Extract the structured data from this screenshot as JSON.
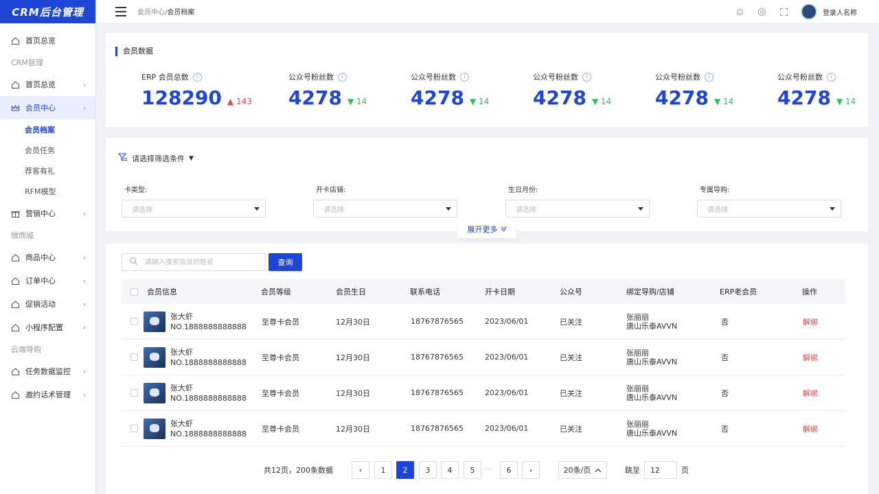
{
  "app": {
    "logo": "CRM后台管理"
  },
  "topbar": {
    "breadcrumb_parent": "会员中心/",
    "breadcrumb_current": "会员档案",
    "username": "登录人名称"
  },
  "sidebar": {
    "items": [
      {
        "label": "首页总览"
      },
      {
        "group": "CRM管理"
      },
      {
        "label": "首页总览"
      },
      {
        "label": "会员中心"
      },
      {
        "sub": [
          "会员档案",
          "会员任务",
          "荐客有礼",
          "RFM模型"
        ]
      },
      {
        "label": "营销中心"
      },
      {
        "group": "微商城"
      },
      {
        "label": "商品中心"
      },
      {
        "label": "订单中心"
      },
      {
        "label": "促销活动"
      },
      {
        "label": "小程序配置"
      },
      {
        "group": "云端导购"
      },
      {
        "label": "任务数据监控"
      },
      {
        "label": "邀约话术管理"
      }
    ]
  },
  "stats": {
    "title": "会员数据",
    "items": [
      {
        "label": "ERP 会员总数",
        "value": "128290",
        "delta": "143",
        "direction": "up"
      },
      {
        "label": "公众号粉丝数",
        "value": "4278",
        "delta": "14",
        "direction": "down"
      },
      {
        "label": "公众号粉丝数",
        "value": "4278",
        "delta": "14",
        "direction": "down"
      },
      {
        "label": "公众号粉丝数",
        "value": "4278",
        "delta": "14",
        "direction": "down"
      },
      {
        "label": "公众号粉丝数",
        "value": "4278",
        "delta": "14",
        "direction": "down"
      },
      {
        "label": "公众号粉丝数",
        "value": "4278",
        "delta": "14",
        "direction": "down"
      }
    ]
  },
  "filter": {
    "title": "请选择筛选条件",
    "fields": [
      {
        "label": "卡类型:",
        "placeholder": "请选择"
      },
      {
        "label": "开卡店铺:",
        "placeholder": "请选择"
      },
      {
        "label": "生日月份:",
        "placeholder": "请选择"
      },
      {
        "label": "专属导购:",
        "placeholder": "请选择"
      }
    ],
    "expand_label": "展开更多"
  },
  "search": {
    "placeholder": "请输入搜索会员的姓名",
    "button": "查询"
  },
  "table": {
    "columns": [
      "会员信息",
      "会员等级",
      "会员生日",
      "联系电话",
      "开卡日期",
      "公众号",
      "绑定导购/店铺",
      "ERP老会员",
      "操作"
    ],
    "rows": [
      {
        "name": "张大虾",
        "no": "NO.1888888888888",
        "level": "至尊卡会员",
        "birthday": "12月30日",
        "phone": "18767876565",
        "date": "2023/06/01",
        "wechat": "已关注",
        "guide": "张丽丽",
        "store": "唐山乐泰AVVN",
        "erp": "否",
        "action": "解绑"
      },
      {
        "name": "张大虾",
        "no": "NO.1888888888888",
        "level": "至尊卡会员",
        "birthday": "12月30日",
        "phone": "18767876565",
        "date": "2023/06/01",
        "wechat": "已关注",
        "guide": "张丽丽",
        "store": "唐山乐泰AVVN",
        "erp": "否",
        "action": "解绑"
      },
      {
        "name": "张大虾",
        "no": "NO.1888888888888",
        "level": "至尊卡会员",
        "birthday": "12月30日",
        "phone": "18767876565",
        "date": "2023/06/01",
        "wechat": "已关注",
        "guide": "张丽丽",
        "store": "唐山乐泰AVVN",
        "erp": "否",
        "action": "解绑"
      },
      {
        "name": "张大虾",
        "no": "NO.1888888888888",
        "level": "至尊卡会员",
        "birthday": "12月30日",
        "phone": "18767876565",
        "date": "2023/06/01",
        "wechat": "已关注",
        "guide": "张丽丽",
        "store": "唐山乐泰AVVN",
        "erp": "否",
        "action": "解绑"
      }
    ]
  },
  "pagination": {
    "total": "共12页，200条数据",
    "pages": [
      "1",
      "2",
      "3",
      "4",
      "5",
      "6"
    ],
    "current": "2",
    "ellipsis": "···",
    "page_size": "20条/页",
    "jump_label": "跳至",
    "jump_value": "12",
    "jump_unit": "页"
  },
  "colors": {
    "primary": "#1e46d6",
    "up": "#e64545",
    "down": "#2fbf5a"
  }
}
